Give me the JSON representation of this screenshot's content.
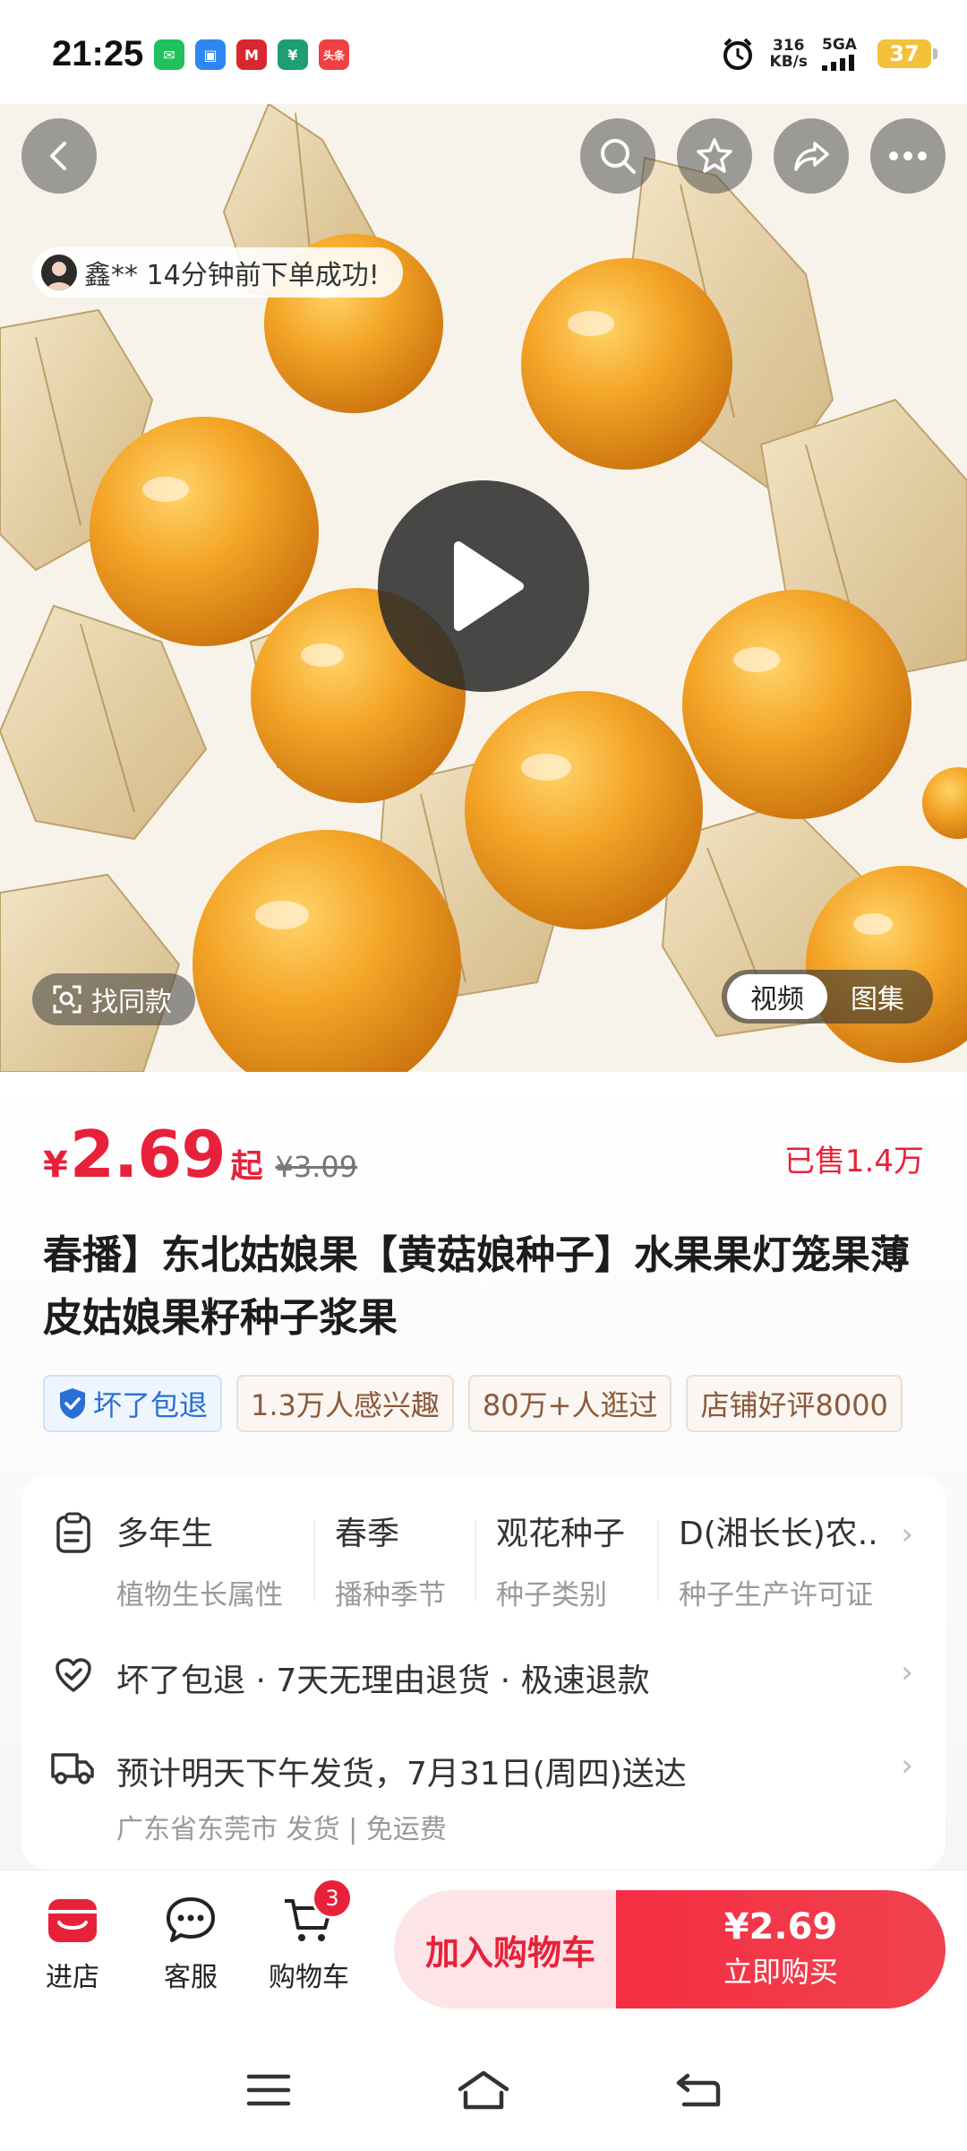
{
  "status_bar": {
    "time": "21:25",
    "app_icons": [
      {
        "name": "wechat-icon",
        "color": "#20c05c",
        "glyph": "✉"
      },
      {
        "name": "app-blue-icon",
        "color": "#2f86f0",
        "glyph": "▣"
      },
      {
        "name": "metro-icon",
        "color": "#d7282f",
        "glyph": "M"
      },
      {
        "name": "bank-icon",
        "color": "#1f9e73",
        "glyph": "¥"
      },
      {
        "name": "toutiao-icon",
        "color": "#f04142",
        "glyph": "头条"
      }
    ],
    "net_speed_value": "316",
    "net_speed_unit": "KB/s",
    "network": "5GA",
    "battery": "37"
  },
  "hero": {
    "toast_text": "鑫** 14分钟前下单成功!",
    "find_same_label": "找同款",
    "tabs": [
      {
        "label": "视频",
        "active": true
      },
      {
        "label": "图集",
        "active": false
      }
    ]
  },
  "product": {
    "price_symbol": "¥",
    "price": "2.69",
    "price_suffix": "起",
    "original_price": "¥3.09",
    "sold": "已售1.4万",
    "title": "春播】东北姑娘果【黄菇娘种子】水果果灯笼果薄皮姑娘果籽种子浆果",
    "tags": [
      {
        "label": "坏了包退",
        "type": "guarantee"
      },
      {
        "label": "1.3万人感兴趣",
        "type": "normal"
      },
      {
        "label": "80万+人逛过",
        "type": "normal"
      },
      {
        "label": "店铺好评8000",
        "type": "normal"
      }
    ]
  },
  "attributes": [
    {
      "value": "多年生",
      "key": "植物生长属性"
    },
    {
      "value": "春季",
      "key": "播种季节"
    },
    {
      "value": "观花种子",
      "key": "种子类别"
    },
    {
      "value": "D(湘长长)农..",
      "key": "种子生产许可证"
    }
  ],
  "services": {
    "guarantee_text": "坏了包退 · 7天无理由退货 · 极速退款",
    "delivery_text": "预计明天下午发货，7月31日(周四)送达",
    "delivery_sub": "广东省东莞市 发货 | 免运费"
  },
  "action_bar": {
    "store_label": "进店",
    "service_label": "客服",
    "cart_label": "购物车",
    "cart_badge": "3",
    "add_cart_label": "加入购物车",
    "buy_price": "¥2.69",
    "buy_label": "立即购买"
  },
  "colors": {
    "accent": "#e8213a",
    "fruit": "#f3a021",
    "husk": "#e8d3a6"
  }
}
